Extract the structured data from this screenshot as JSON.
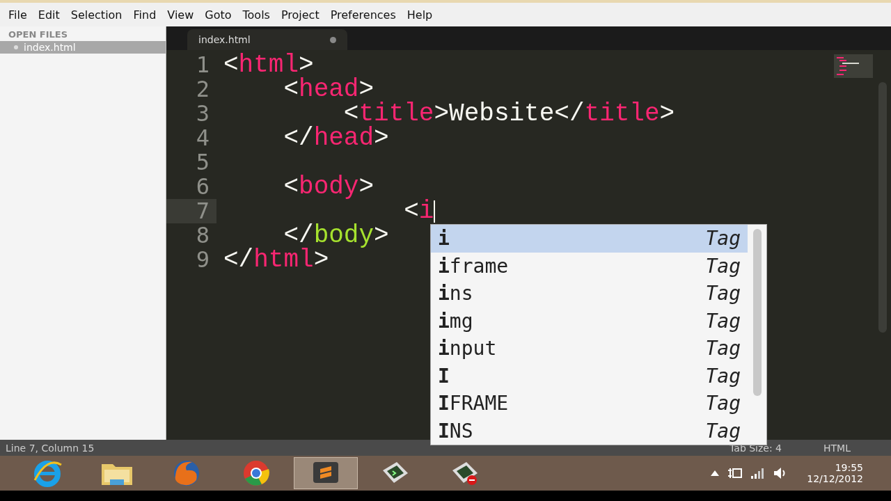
{
  "menu": [
    "File",
    "Edit",
    "Selection",
    "Find",
    "View",
    "Goto",
    "Tools",
    "Project",
    "Preferences",
    "Help"
  ],
  "sidebar": {
    "header": "OPEN FILES",
    "items": [
      {
        "label": "index.html",
        "selected": true
      }
    ]
  },
  "tabs": [
    {
      "label": "index.html",
      "selected": true,
      "dirty": true
    }
  ],
  "editor": {
    "lines": [
      {
        "number": "1",
        "tokens": [
          {
            "kind": "punct",
            "text": "<"
          },
          {
            "kind": "tag",
            "text": "html"
          },
          {
            "kind": "punct",
            "text": ">"
          }
        ]
      },
      {
        "number": "2",
        "tokens": [
          {
            "kind": "punct",
            "text": "    <"
          },
          {
            "kind": "tag",
            "text": "head"
          },
          {
            "kind": "punct",
            "text": ">"
          }
        ]
      },
      {
        "number": "3",
        "tokens": [
          {
            "kind": "punct",
            "text": "        <"
          },
          {
            "kind": "tag",
            "text": "title"
          },
          {
            "kind": "punct",
            "text": ">"
          },
          {
            "kind": "text",
            "text": "Website"
          },
          {
            "kind": "punct",
            "text": "</"
          },
          {
            "kind": "tag",
            "text": "title"
          },
          {
            "kind": "punct",
            "text": ">"
          }
        ]
      },
      {
        "number": "4",
        "tokens": [
          {
            "kind": "punct",
            "text": "    </"
          },
          {
            "kind": "tag",
            "text": "head"
          },
          {
            "kind": "punct",
            "text": ">"
          }
        ]
      },
      {
        "number": "5"
      },
      {
        "number": "6",
        "tokens": [
          {
            "kind": "punct",
            "text": "    <"
          },
          {
            "kind": "tag",
            "text": "body"
          },
          {
            "kind": "punct",
            "text": ">"
          }
        ]
      },
      {
        "number": "7",
        "current": true,
        "tokens": [
          {
            "kind": "punct",
            "text": "            <"
          },
          {
            "kind": "tag",
            "text": "i"
          }
        ]
      },
      {
        "number": "8",
        "tokens": [
          {
            "kind": "punct",
            "text": "    </"
          },
          {
            "kind": "tag-alt",
            "text": "body"
          },
          {
            "kind": "punct",
            "text": ">"
          }
        ]
      },
      {
        "number": "9",
        "tokens": [
          {
            "kind": "punct",
            "text": "</"
          },
          {
            "kind": "tag",
            "text": "html"
          },
          {
            "kind": "punct",
            "text": ">"
          }
        ]
      }
    ]
  },
  "autocomplete": [
    {
      "label": "**i**",
      "type": "Tag",
      "selected": true
    },
    {
      "label": "**i**frame",
      "type": "Tag",
      "selected": false
    },
    {
      "label": "**i**ns",
      "type": "Tag",
      "selected": false
    },
    {
      "label": "**i**mg",
      "type": "Tag",
      "selected": false
    },
    {
      "label": "**i**nput",
      "type": "Tag",
      "selected": false
    },
    {
      "label": "**I**",
      "type": "Tag",
      "selected": false
    },
    {
      "label": "**I**FRAME",
      "type": "Tag",
      "selected": false
    },
    {
      "label": "**I**NS",
      "type": "Tag",
      "selected": false
    }
  ],
  "status_bar": {
    "position": "Line 7, Column 15",
    "tab_size": "Tab Size: 4",
    "syntax": "HTML"
  },
  "taskbar": {
    "apps": [
      {
        "kind": "ie",
        "active": false
      },
      {
        "kind": "folder",
        "active": false
      },
      {
        "kind": "firefox",
        "active": false
      },
      {
        "kind": "chrome",
        "active": false
      },
      {
        "kind": "sublime",
        "active": true
      },
      {
        "kind": "terminal",
        "active": false
      },
      {
        "kind": "terminal-stop",
        "active": false
      }
    ],
    "time": "19:55",
    "date": "12/12/2012"
  }
}
